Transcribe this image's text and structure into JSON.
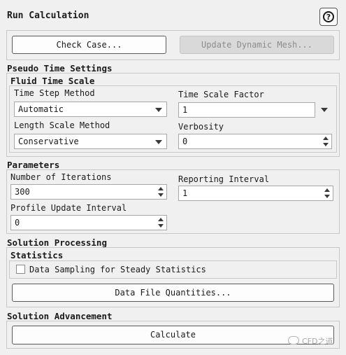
{
  "panel": {
    "title": "Run Calculation",
    "help_glyph": "?"
  },
  "top_buttons": {
    "check_case": "Check Case...",
    "update_mesh": "Update Dynamic Mesh..."
  },
  "pseudo_time": {
    "heading": "Pseudo Time Settings",
    "subheading": "Fluid Time Scale",
    "time_step_method_label": "Time Step Method",
    "time_step_method_value": "Automatic",
    "time_scale_factor_label": "Time Scale Factor",
    "time_scale_factor_value": "1",
    "length_scale_method_label": "Length Scale Method",
    "length_scale_method_value": "Conservative",
    "verbosity_label": "Verbosity",
    "verbosity_value": "0"
  },
  "parameters": {
    "heading": "Parameters",
    "iterations_label": "Number of Iterations",
    "iterations_value": "300",
    "reporting_label": "Reporting Interval",
    "reporting_value": "1",
    "profile_label": "Profile Update Interval",
    "profile_value": "0"
  },
  "solution_processing": {
    "heading": "Solution Processing",
    "statistics_heading": "Statistics",
    "sampling_label": "Data Sampling for Steady Statistics",
    "sampling_checked": false,
    "data_file_button": "Data File Quantities..."
  },
  "solution_advancement": {
    "heading": "Solution Advancement",
    "calculate_button": "Calculate"
  },
  "watermark": {
    "text": "CFD之道"
  }
}
